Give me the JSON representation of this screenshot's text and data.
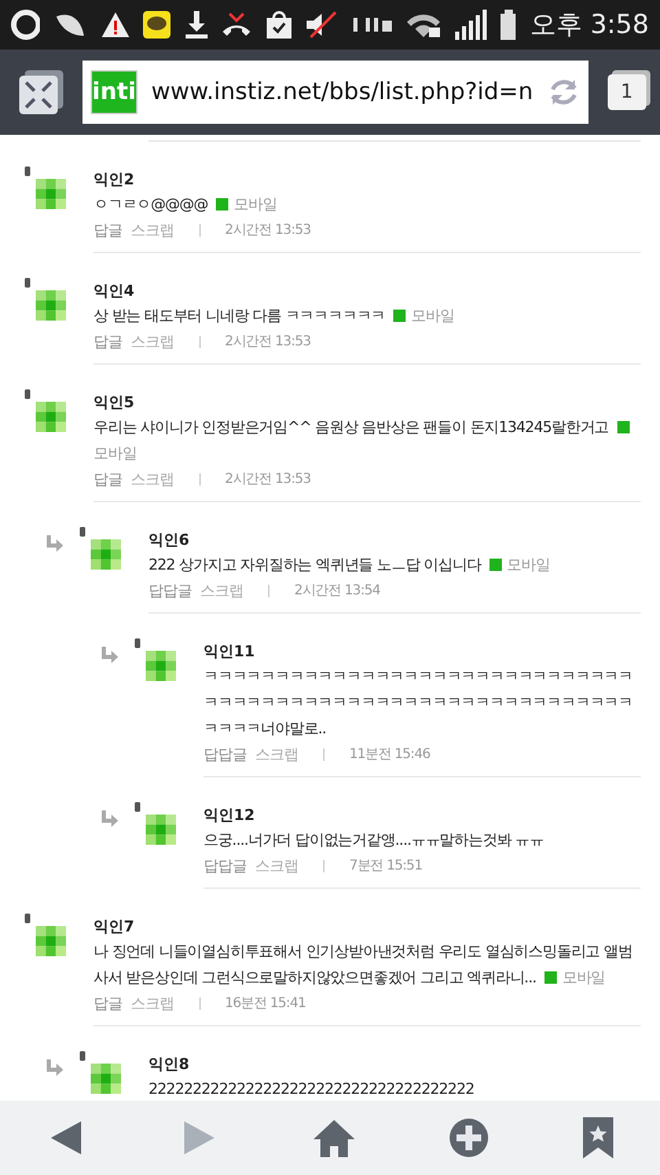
{
  "status_bar": {
    "time": "오후 3:58"
  },
  "browser": {
    "logo": "inti",
    "url": "www.instiz.net/bbs/list.php?id=n",
    "tab_count": "1"
  },
  "comments": [
    {
      "name": "익인2",
      "body": "ㅇㄱㄹㅇ@@@@",
      "tag": "모바일",
      "reply_label": "답글",
      "scrap_label": "스크랩",
      "time": "2시간전 13:53"
    },
    {
      "name": "익인4",
      "body": "상 받는 태도부터 니네랑 다름 ㅋㅋㅋㅋㅋㅋㅋ",
      "tag": "모바일",
      "reply_label": "답글",
      "scrap_label": "스크랩",
      "time": "2시간전 13:53"
    },
    {
      "name": "익인5",
      "body": "우리는 샤이니가 인정받은거임^^ 음원상 음반상은 팬들이 돈지134245랄한거고",
      "tag": "모바일",
      "reply_label": "답글",
      "scrap_label": "스크랩",
      "time": "2시간전 13:53",
      "children": [
        {
          "name": "익인6",
          "body": "222 상가지고 자위질하는 엑퀴년들 노ㅡ답 이십니다",
          "tag": "모바일",
          "reply_label": "답답글",
          "scrap_label": "스크랩",
          "time": "2시간전 13:54",
          "children": [
            {
              "name": "익인11",
              "body": "ㅋㅋㅋㅋㅋㅋㅋㅋㅋㅋㅋㅋㅋㅋㅋㅋㅋㅋㅋㅋㅋㅋㅋㅋㅋㅋㅋㅋㅋㅋㅋㅋㅋㅋㅋㅋㅋㅋㅋㅋㅋㅋㅋㅋㅋㅋㅋㅋㅋㅋㅋㅋㅋㅋㅋㅋㅋㅋㅋㅋㅋㅋㅋㅋ너야말로..",
              "reply_label": "답답글",
              "scrap_label": "스크랩",
              "time": "11분전 15:46"
            },
            {
              "name": "익인12",
              "body": "으궁....너가더 답이없는거같앵....ㅠㅠ말하는것봐 ㅠㅠ",
              "reply_label": "답답글",
              "scrap_label": "스크랩",
              "time": "7분전 15:51"
            }
          ]
        }
      ]
    },
    {
      "name": "익인7",
      "body": "나 징언데 니들이열심히투표해서 인기상받아낸것처럼 우리도 열심히스밍돌리고 앨범사서 받은상인데 그런식으로말하지않았으면좋겠어 그리고 엑퀴라니...",
      "tag": "모바일",
      "reply_label": "답글",
      "scrap_label": "스크랩",
      "time": "16분전 15:41",
      "children": [
        {
          "name": "익인8",
          "body": "2222222222222222222222222222222222222"
        }
      ]
    }
  ],
  "toolbar": [
    {
      "kind": "back",
      "disabled": false
    },
    {
      "kind": "forward",
      "disabled": true
    },
    {
      "kind": "home",
      "disabled": false
    },
    {
      "kind": "add",
      "disabled": false
    },
    {
      "kind": "bookmark",
      "disabled": false
    }
  ]
}
